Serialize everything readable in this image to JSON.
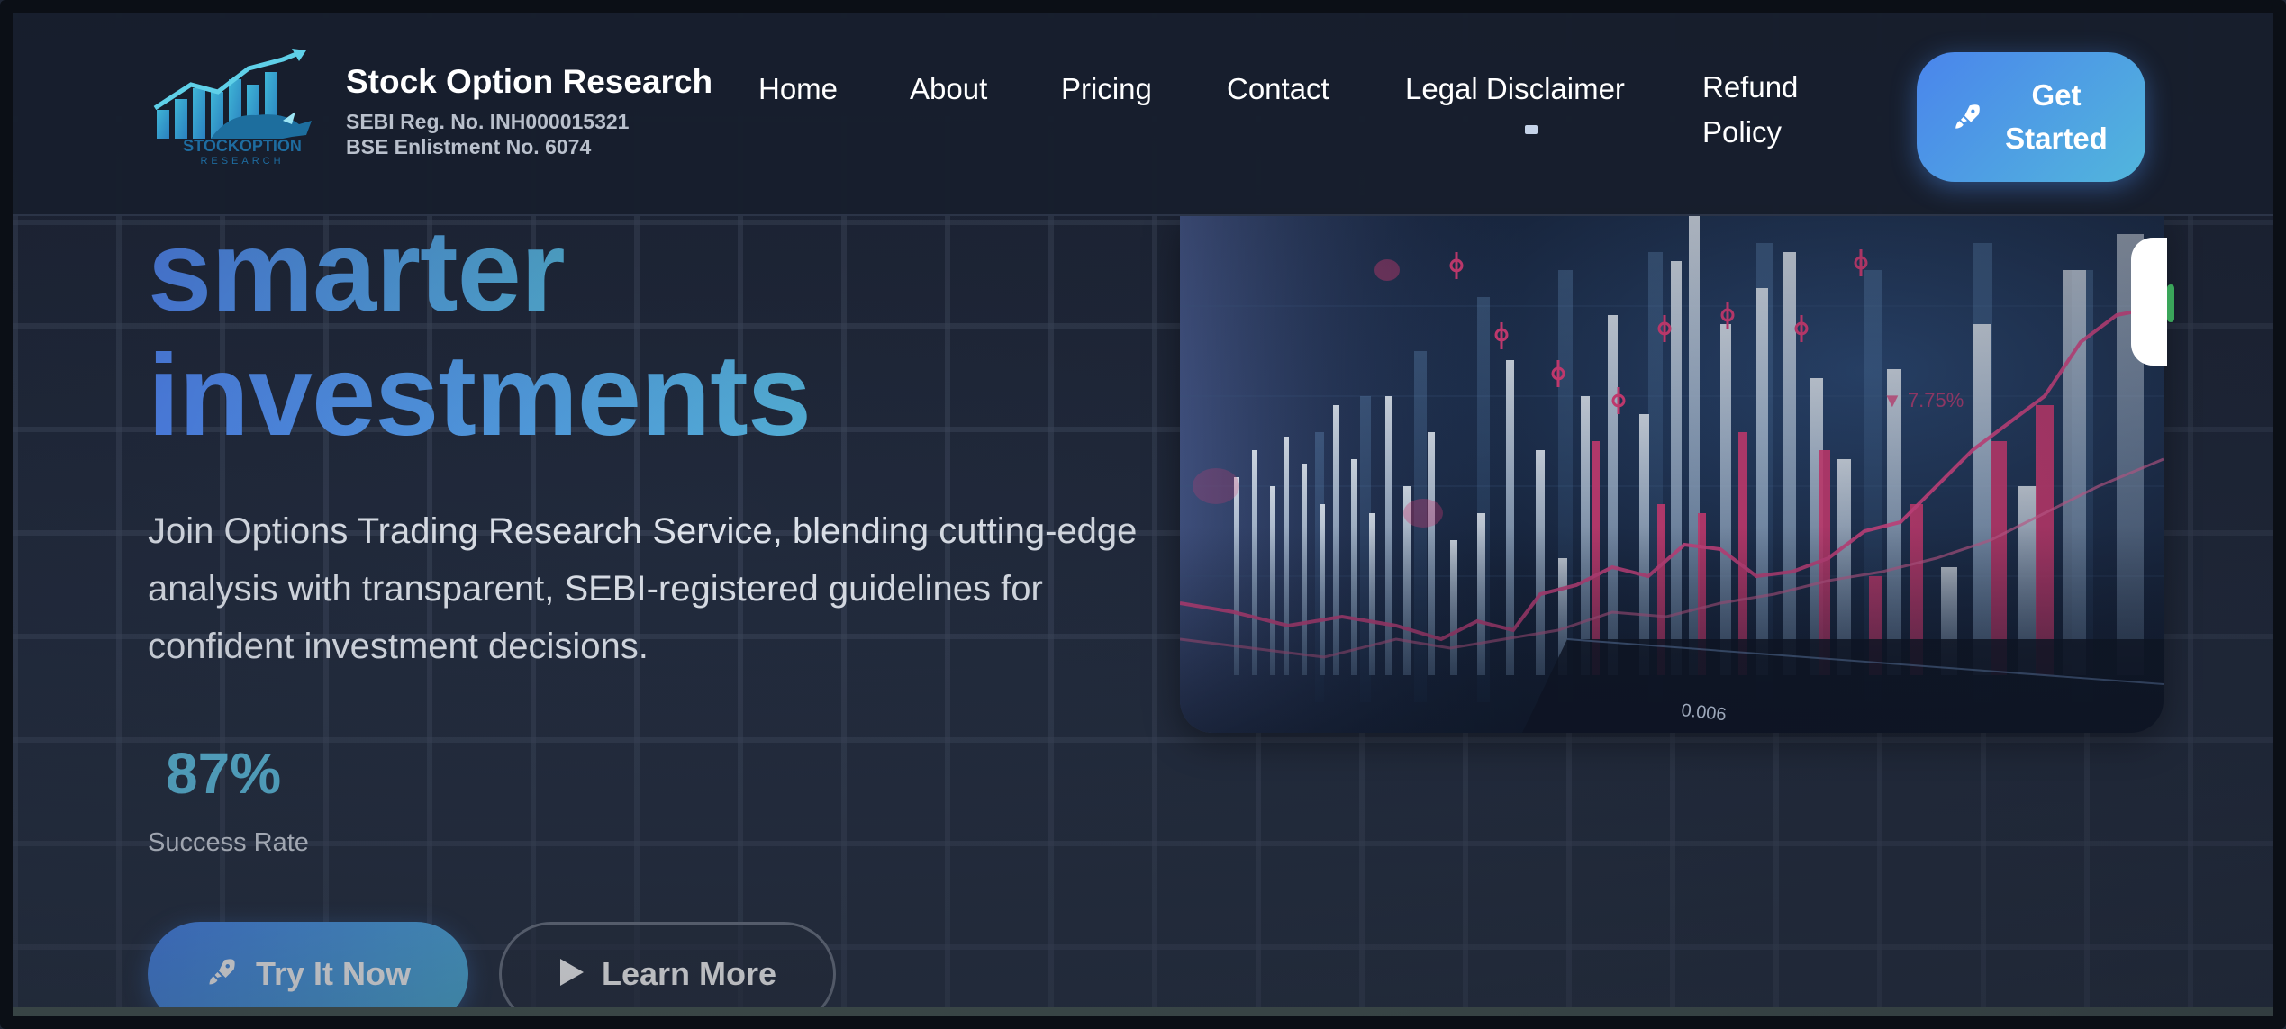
{
  "brand": {
    "name": "Stock Option Research",
    "reg_line": "SEBI Reg. No. INH000015321",
    "bse_line": "BSE Enlistment No. 6074",
    "logo_icon": "bull-chart-logo-icon"
  },
  "nav": {
    "home": "Home",
    "about": "About",
    "pricing": "Pricing",
    "contact": "Contact",
    "legal": "Legal Disclaimer",
    "refund": "Refund Policy",
    "get_started": "Get Started"
  },
  "hero": {
    "headline_line1": "smarter",
    "headline_line2": "investments",
    "description": "Join Options Trading Research Service, blending cutting-edge analysis with transparent, SEBI-registered guidelines for confident investment decisions.",
    "stat_value": "87%",
    "stat_label": "Success Rate",
    "try_button": "Try It Now",
    "learn_button": "Learn More"
  },
  "image": {
    "price_tag": "0.006",
    "delta_tag": "▼ 7.75%"
  },
  "colors": {
    "accent_start": "#4a85ec",
    "accent_end": "#52b6dc",
    "background": "#1f2635",
    "stat": "#5cb8d8"
  },
  "icons": {
    "rocket": "rocket-icon",
    "play": "play-icon",
    "chevron": "chevron-down-icon"
  }
}
